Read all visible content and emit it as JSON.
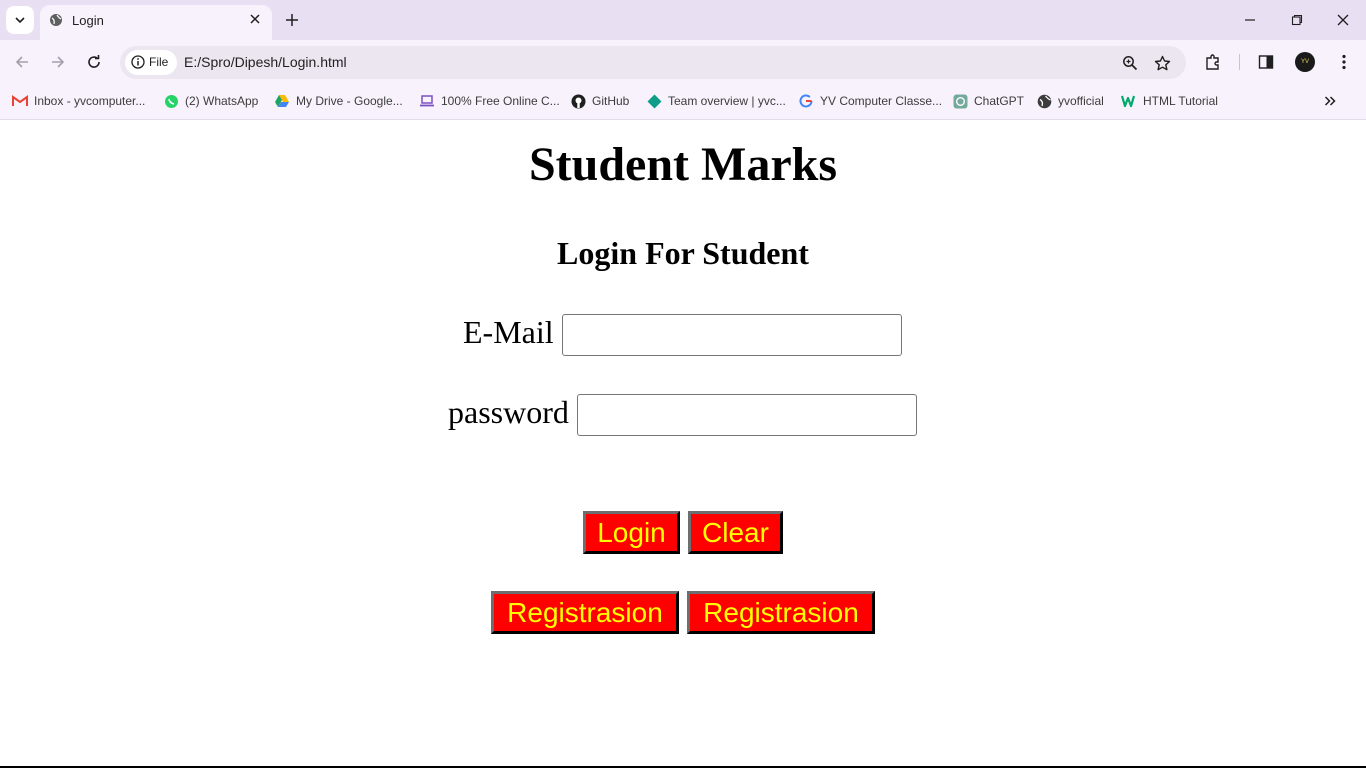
{
  "browser": {
    "tab_title": "Login",
    "chip_label": "File",
    "url": "E:/Spro/Dipesh/Login.html",
    "avatar_text": "YV"
  },
  "bookmarks": [
    {
      "label": "Inbox - yvcomputer...",
      "icon": "gmail-icon",
      "color": "#ea4335"
    },
    {
      "label": "(2) WhatsApp",
      "icon": "whatsapp-icon",
      "color": "#25d366"
    },
    {
      "label": "My Drive - Google...",
      "icon": "google-drive-icon",
      "color": "#1fa463"
    },
    {
      "label": "100% Free Online C...",
      "icon": "laptop-icon",
      "color": "#7b4fc4"
    },
    {
      "label": "GitHub",
      "icon": "github-icon",
      "color": "#1f1f1f"
    },
    {
      "label": "Team overview | yvc...",
      "icon": "diamond-icon",
      "color": "#0f9d8a"
    },
    {
      "label": "YV Computer Classe...",
      "icon": "google-icon",
      "color": "#4285f4"
    },
    {
      "label": "ChatGPT",
      "icon": "chatgpt-icon",
      "color": "#74aa9c"
    },
    {
      "label": "yvofficial",
      "icon": "globe-icon",
      "color": "#3c3c3c"
    },
    {
      "label": "HTML Tutorial",
      "icon": "w3schools-icon",
      "color": "#04aa6d"
    }
  ],
  "page": {
    "heading": "Student Marks",
    "subheading": "Login For Student",
    "email_label": "E-Mail",
    "email_value": "",
    "password_label": "password",
    "password_value": "",
    "login_button": "Login",
    "clear_button": "Clear",
    "register_button_1": "Registrasion",
    "register_button_2": "Registrasion",
    "button_bg": "#ff0000",
    "button_text_color": "#ffff00"
  }
}
